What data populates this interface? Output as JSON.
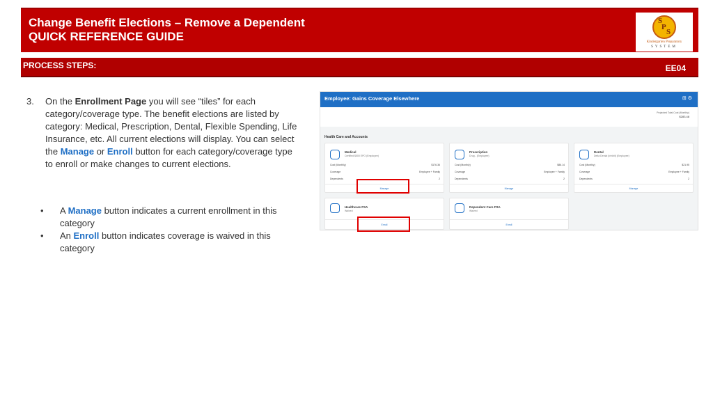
{
  "header": {
    "title": "Change Benefit Elections – Remove a Dependent",
    "subtitle": "QUICK REFERENCE GUIDE",
    "logo": {
      "letters": [
        "S",
        "P",
        "S"
      ],
      "tagline": "Kindergarten Preparatory",
      "system": "SYSTEM"
    }
  },
  "process": {
    "label": "PROCESS STEPS:",
    "code": "EE04"
  },
  "step": {
    "number": "3.",
    "t1": "On the ",
    "b1": "Enrollment Page",
    "t2": " you will see “tiles” for each category/coverage type.  The benefit elections are listed by category: Medical, Prescription, Dental, Flexible Spending, Life Insurance, etc. All current elections will display.  You can select the ",
    "manage": "Manage",
    "or": " or ",
    "enroll": "Enroll",
    "t3": " button for each category/coverage type to enroll or make changes to current elections."
  },
  "bullets": {
    "marker": "•",
    "b1_pre": "A ",
    "b1_kw": "Manage",
    "b1_post": " button indicates a current enrollment in this category",
    "b2_pre": "An ",
    "b2_kw": "Enroll",
    "b2_post": " button indicates coverage is waived in this category"
  },
  "screenshot": {
    "title": "Employee: Gains Coverage Elsewhere",
    "icons": "⊞ ⚙",
    "total_label": "Projected Total Cost (Monthly)",
    "total_value": "$283.48",
    "section": "Health Care and Accounts",
    "cards": [
      {
        "name": "Medical",
        "plan": "Certified $500 EPO (Employee)",
        "rows": [
          [
            "Cost (Monthly)",
            "$176.36"
          ],
          [
            "Coverage",
            "Employee + Family"
          ],
          [
            "Dependents",
            "2"
          ]
        ],
        "button": "Manage"
      },
      {
        "name": "Prescription",
        "plan": "Drug - (Employee)",
        "rows": [
          [
            "Cost (Monthly)",
            "$86.14"
          ],
          [
            "Coverage",
            "Employee + Family"
          ],
          [
            "Dependents",
            "2"
          ]
        ],
        "button": "Manage"
      },
      {
        "name": "Dental",
        "plan": "Delta Dental (Inhibit) (Employee)",
        "rows": [
          [
            "Cost (Monthly)",
            "$21.95"
          ],
          [
            "Coverage",
            "Employee + Family"
          ],
          [
            "Dependents",
            "2"
          ]
        ],
        "button": "Manage"
      },
      {
        "name": "Healthcare FSA",
        "plan": "Waived",
        "rows": [],
        "button": "Enroll"
      },
      {
        "name": "Dependent Care FSA",
        "plan": "Waived",
        "rows": [],
        "button": "Enroll"
      }
    ]
  },
  "colors": {
    "header_red": "#c00000",
    "bar_red": "#b00000",
    "keyword_blue": "#1f6fc5",
    "highlight": "#e00000"
  }
}
